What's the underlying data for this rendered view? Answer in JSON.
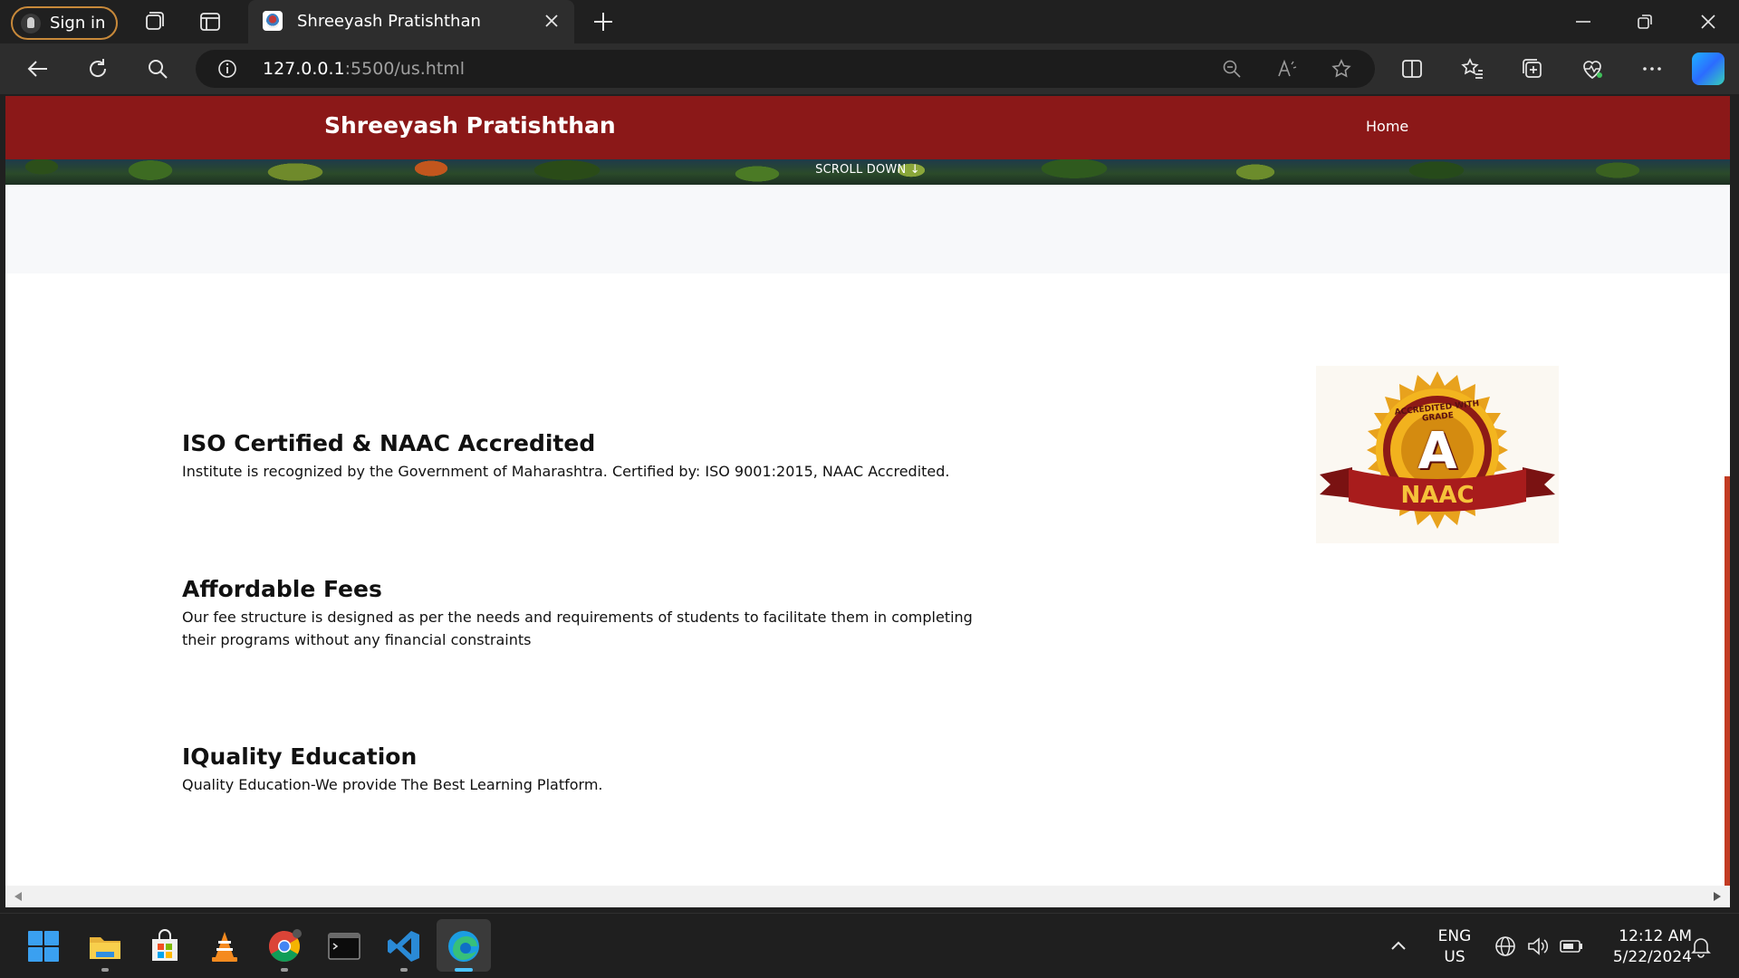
{
  "browser": {
    "signin_label": "Sign in",
    "tab_title": "Shreeyash Pratishthan",
    "url_host": "127.0.0.1",
    "url_rest": ":5500/us.html"
  },
  "site": {
    "brand": "Shreeyash Pratishthan",
    "nav_home": "Home",
    "scroll_down": "SCROLL DOWN ↓"
  },
  "features": [
    {
      "title": "ISO Certified & NAAC Accredited",
      "lines": [
        "Institute is recognized by the Government of Maharashtra. Certified by: ISO 9001:2015, NAAC Accredited."
      ]
    },
    {
      "title": "Affordable Fees",
      "lines": [
        "Our fee structure is designed as per the needs and requirements of students to facilitate them in completing",
        "their programs without any financial constraints"
      ]
    },
    {
      "title": "IQuality Education",
      "lines": [
        "Quality Education-We provide The Best Learning Platform."
      ]
    }
  ],
  "badge": {
    "arc_text": "ACCREDITED WITH GRADE",
    "grade": "A",
    "ribbon": "NAAC"
  },
  "taskbar": {
    "lang_top": "ENG",
    "lang_bottom": "US",
    "time": "12:12 AM",
    "date": "5/22/2024"
  },
  "colors": {
    "header": "#8b1818",
    "badge_gold": "#e8a21d",
    "ribbon": "#9b1a1a"
  }
}
